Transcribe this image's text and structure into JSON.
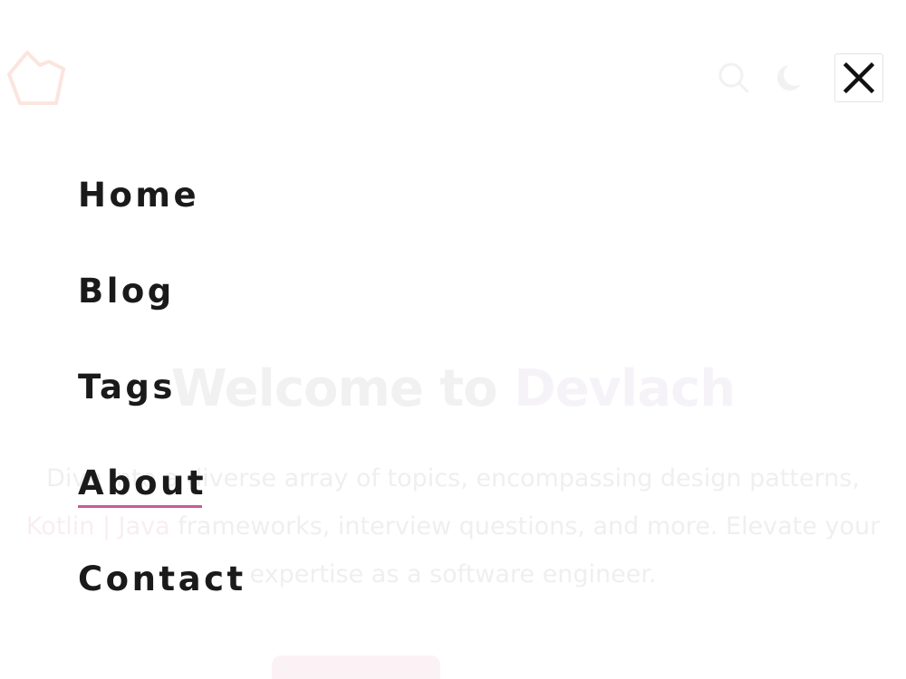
{
  "colors": {
    "accent": "#c85a98",
    "text": "#1a1a1a",
    "faded_text": "#efefef",
    "logo": "#fbe5de",
    "icon_faded": "#f1f1f1"
  },
  "header": {
    "logo_icon": "crown-logo-icon",
    "search_icon": "search-icon",
    "theme_icon": "moon-icon",
    "close_icon": "close-icon"
  },
  "hero": {
    "title_prefix": "Welcome to ",
    "title_brand": "Devlach",
    "description_parts": [
      "Dive into a diverse array of topics, encompassing design patterns, ",
      "Kotlin | Java",
      " frameworks, interview questions, and more. Elevate your expertise as a software engineer."
    ]
  },
  "menu": {
    "active": "About",
    "items": [
      {
        "label": "Home"
      },
      {
        "label": "Blog"
      },
      {
        "label": "Tags"
      },
      {
        "label": "About"
      },
      {
        "label": "Contact"
      }
    ]
  }
}
